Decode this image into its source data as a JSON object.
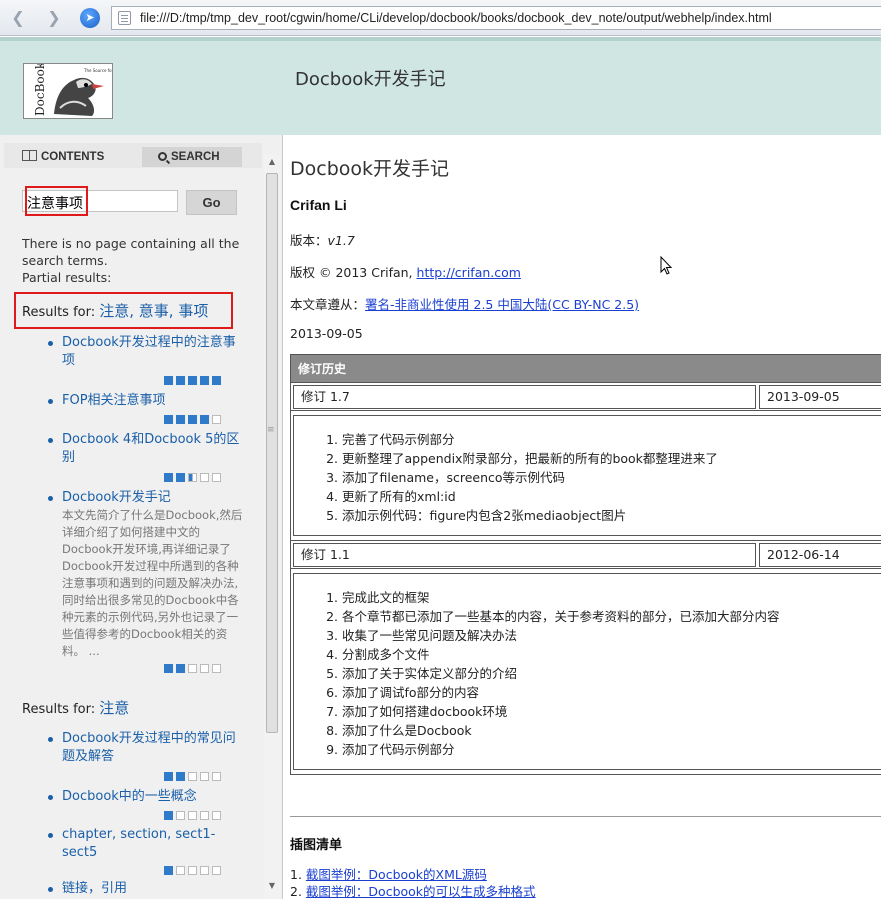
{
  "browser": {
    "back_icon": "back-arrow-icon",
    "forward_icon": "forward-arrow-icon",
    "url": "file:///D:/tmp/tmp_dev_root/cgwin/home/CLi/develop/docbook/books/docbook_dev_note/output/webhelp/index.html"
  },
  "header": {
    "title": "Docbook开发手记",
    "logo_icon": "docbook-duck-logo"
  },
  "sidebar": {
    "tabs": {
      "contents": "CONTENTS",
      "search": "SEARCH"
    },
    "search": {
      "value": "注意事项",
      "go_label": "Go"
    },
    "no_match_text": "There is no page containing all the search terms.",
    "partial_text": "Partial results:",
    "groups": [
      {
        "prefix": "Results for:",
        "terms": "注意, 意事, 事项",
        "results": [
          {
            "title": "Docbook开发过程中的注意事项",
            "rating": 5,
            "desc": ""
          },
          {
            "title": "FOP相关注意事项",
            "rating": 4,
            "desc": ""
          },
          {
            "title": "Docbook 4和Docbook 5的区别",
            "rating": 2.5,
            "desc": ""
          },
          {
            "title": "Docbook开发手记",
            "rating": 2,
            "desc": "本文先简介了什么是Docbook,然后详细介绍了如何搭建中文的Docbook开发环境,再详细记录了Docbook开发过程中所遇到的各种注意事项和遇到的问题及解决办法,同时给出很多常见的Docbook中各种元素的示例代码,另外也记录了一些值得参考的Docbook相关的资料。 ..."
          }
        ]
      },
      {
        "prefix": "Results for:",
        "terms": "注意",
        "results": [
          {
            "title": "Docbook开发过程中的常见问题及解答",
            "rating": 2,
            "desc": ""
          },
          {
            "title": "Docbook中的一些概念",
            "rating": 1,
            "desc": ""
          },
          {
            "title": "chapter, section, sect1-sect5",
            "rating": 1,
            "desc": ""
          },
          {
            "title": "链接，引用",
            "rating": 0,
            "desc": ""
          }
        ]
      }
    ]
  },
  "content": {
    "title": "Docbook开发手记",
    "author": "Crifan Li",
    "version_label": "版本：",
    "version_value": "v1.7",
    "copyright_prefix": "版权 © 2013 Crifan, ",
    "copyright_link": "http://crifan.com",
    "license_prefix": "本文章遵从：",
    "license_link": "署名-非商业性使用 2.5 中国大陆(CC BY-NC 2.5)",
    "date": "2013-09-05",
    "revision_history": {
      "heading": "修订历史",
      "revisions": [
        {
          "label": "修订 1.7",
          "date": "2013-09-05",
          "items": [
            "完善了代码示例部分",
            "更新整理了appendix附录部分，把最新的所有的book都整理进来了",
            "添加了filename，screenco等示例代码",
            "更新了所有的xml:id",
            "添加示例代码：figure内包含2张mediaobject图片"
          ]
        },
        {
          "label": "修订 1.1",
          "date": "2012-06-14",
          "items": [
            "完成此文的框架",
            "各个章节都已添加了一些基本的内容，关于参考资料的部分，已添加大部分内容",
            "收集了一些常见问题及解决办法",
            "分割成多个文件",
            "添加了关于实体定义部分的介绍",
            "添加了调试fo部分的内容",
            "添加了如何搭建docbook环境",
            "添加了什么是Docbook",
            "添加了代码示例部分"
          ]
        }
      ]
    },
    "list_of_figures": {
      "heading": "插图清单",
      "items": [
        {
          "num": "1.",
          "text": "截图举例：Docbook的XML源码"
        },
        {
          "num": "2.",
          "text": "截图举例：Docbook的可以生成多种格式"
        }
      ]
    }
  }
}
